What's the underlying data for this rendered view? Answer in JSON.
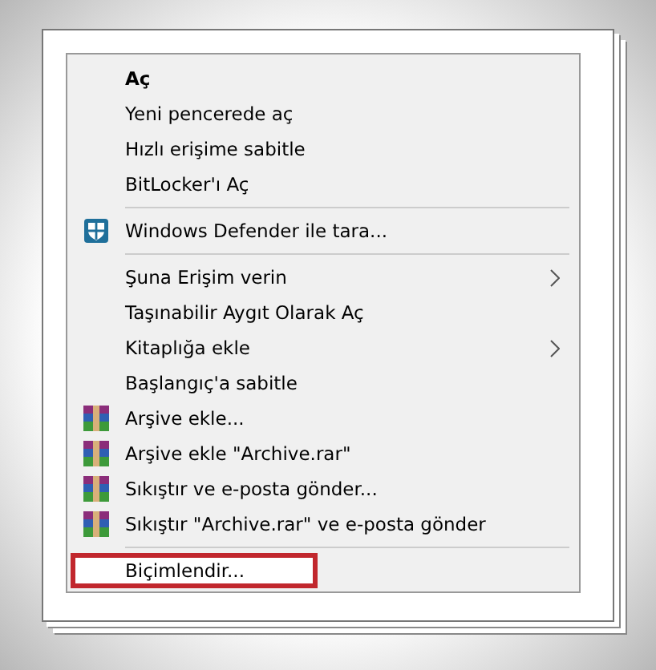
{
  "context_menu": {
    "items": [
      {
        "kind": "plain",
        "label": "Aç",
        "bold": true,
        "submenu": false,
        "highlighted": false
      },
      {
        "kind": "plain",
        "label": "Yeni pencerede aç",
        "bold": false,
        "submenu": false,
        "highlighted": false
      },
      {
        "kind": "plain",
        "label": "Hızlı erişime sabitle",
        "bold": false,
        "submenu": false,
        "highlighted": false
      },
      {
        "kind": "plain",
        "label": "BitLocker'ı Aç",
        "bold": false,
        "submenu": false,
        "highlighted": false
      },
      {
        "kind": "separator"
      },
      {
        "kind": "shield",
        "label": "Windows Defender ile tara...",
        "bold": false,
        "submenu": false,
        "highlighted": false
      },
      {
        "kind": "separator"
      },
      {
        "kind": "plain",
        "label": "Şuna Erişim verin",
        "bold": false,
        "submenu": true,
        "highlighted": false
      },
      {
        "kind": "plain",
        "label": "Taşınabilir Aygıt Olarak Aç",
        "bold": false,
        "submenu": false,
        "highlighted": false
      },
      {
        "kind": "plain",
        "label": "Kitaplığa ekle",
        "bold": false,
        "submenu": true,
        "highlighted": false
      },
      {
        "kind": "plain",
        "label": "Başlangıç'a sabitle",
        "bold": false,
        "submenu": false,
        "highlighted": false
      },
      {
        "kind": "archive",
        "label": "Arşive ekle...",
        "bold": false,
        "submenu": false,
        "highlighted": false
      },
      {
        "kind": "archive",
        "label": "Arşive ekle \"Archive.rar\"",
        "bold": false,
        "submenu": false,
        "highlighted": false
      },
      {
        "kind": "archive",
        "label": "Sıkıştır ve e-posta gönder...",
        "bold": false,
        "submenu": false,
        "highlighted": false
      },
      {
        "kind": "archive",
        "label": "Sıkıştır \"Archive.rar\" ve e-posta gönder",
        "bold": false,
        "submenu": false,
        "highlighted": false
      },
      {
        "kind": "separator"
      },
      {
        "kind": "plain",
        "label": "Biçimlendir...",
        "bold": false,
        "submenu": false,
        "highlighted": true
      }
    ]
  }
}
